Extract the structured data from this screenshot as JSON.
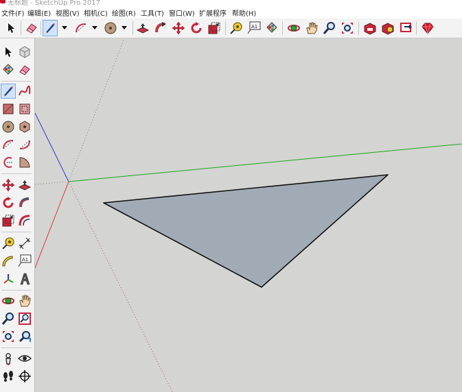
{
  "window": {
    "title": "无标题 - SketchUp Pro 2017"
  },
  "menu": [
    "文件(F)",
    "编辑(E)",
    "视图(V)",
    "相机(C)",
    "绘图(R)",
    "工具(T)",
    "窗口(W)",
    "扩展程序",
    "帮助(H)"
  ],
  "toolbar": {
    "items": [
      "select-tool",
      "eraser-tool",
      "pencil-line-tool",
      "line-dropdown",
      "arc-tool",
      "arc-dropdown",
      "circle-tool",
      "circle-dropdown",
      "push-pull-tool",
      "follow-me-tool",
      "move-tool",
      "rotate-tool",
      "scale-tool",
      "tape-measure-tool",
      "text-tool",
      "paint-bucket-tool",
      "orbit-tool",
      "pan-tool",
      "zoom-tool",
      "zoom-extents-tool",
      "warehouse-tool",
      "extension-warehouse-tool",
      "share-model-tool",
      "ruby-console-tool"
    ],
    "text_tool_label": "A1"
  },
  "left_tools": [
    "select-tool",
    "component-tool",
    "paint-bucket-tool",
    "eraser-tool",
    "line-tool",
    "freehand-tool",
    "rectangle-tool",
    "rotated-rectangle-tool",
    "circle-tool",
    "polygon-tool",
    "arc-tool",
    "two-point-arc-tool",
    "three-point-arc-tool",
    "pie-tool",
    "move-tool",
    "push-pull-tool",
    "rotate-tool",
    "follow-me-tool",
    "scale-tool",
    "offset-tool",
    "tape-measure-tool",
    "dimension-tool",
    "protractor-tool",
    "text-tool",
    "axes-tool",
    "3d-text-tool",
    "orbit-tool",
    "pan-tool",
    "zoom-tool",
    "zoom-window-tool",
    "zoom-extents-tool",
    "previous-view-tool",
    "position-camera-tool",
    "look-around-tool",
    "walk-tool",
    "section-plane-tool"
  ],
  "left_text_tool_label": "A1",
  "colors": {
    "viewport_bg": "#d4d4d2",
    "face_fill": "#a1abb5",
    "edge": "#111111",
    "axis_red": "#d23a3a",
    "axis_green": "#1aa61a",
    "axis_blue": "#3434c8",
    "selection_blue": "#79a7e0"
  }
}
